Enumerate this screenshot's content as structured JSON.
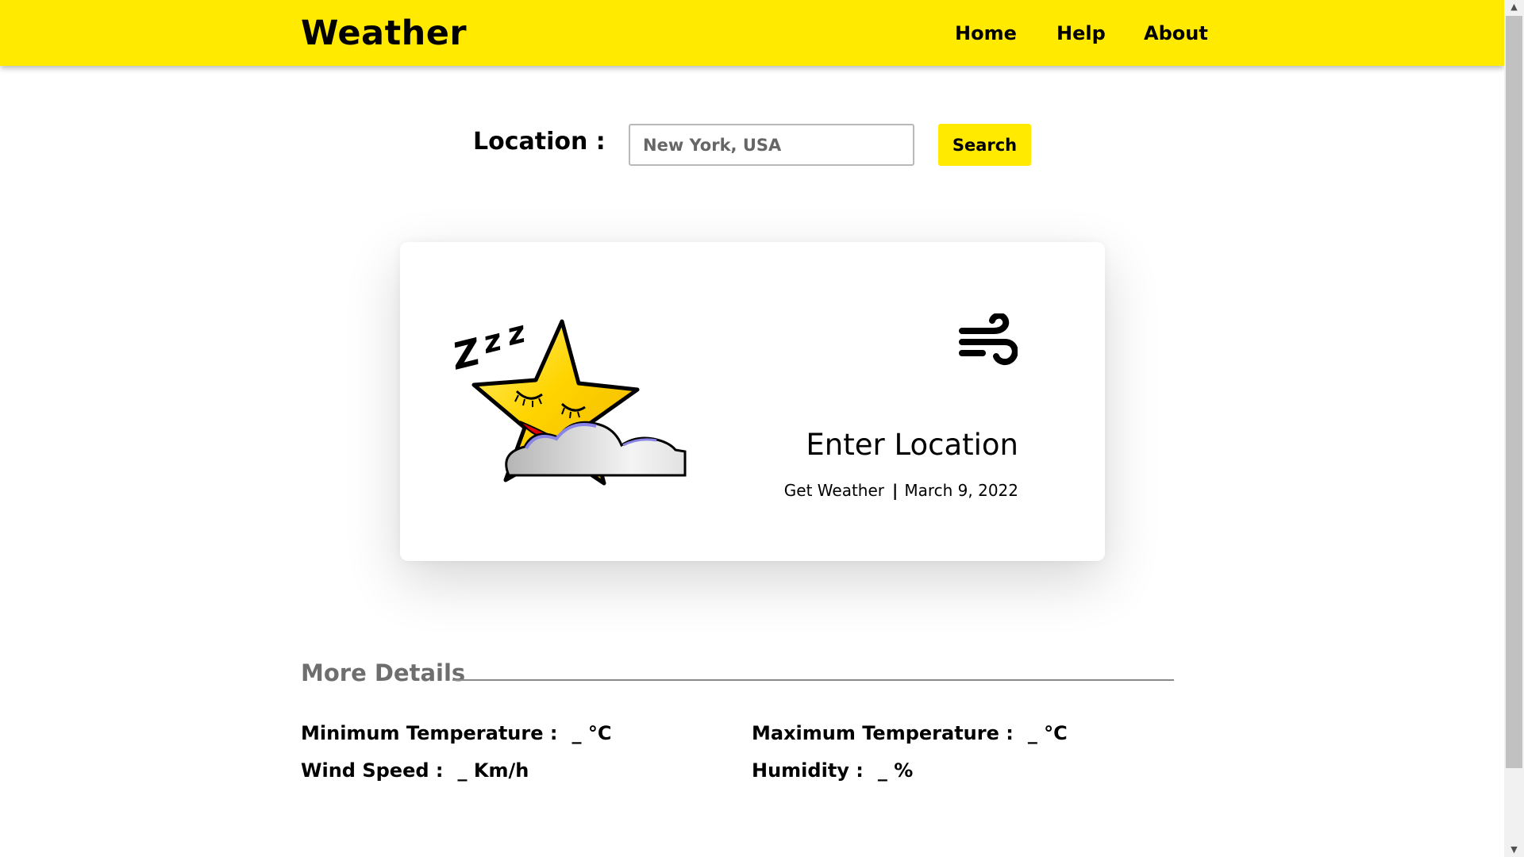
{
  "header": {
    "brand": "Weather",
    "nav": [
      "Home",
      "Help",
      "About"
    ],
    "color": "#ffea00"
  },
  "search": {
    "label": "Location :",
    "placeholder": "New York, USA",
    "value": "",
    "button_label": "Search"
  },
  "card": {
    "icon_left": "sleeping-star-cloud-illustration",
    "icon_right": "wind-icon",
    "title": "Enter Location",
    "subtitle": "Get Weather",
    "separator": "|",
    "date": "March 9, 2022"
  },
  "details": {
    "heading": "More Details",
    "items": [
      {
        "label": "Minimum Temperature :",
        "value": "_ °C"
      },
      {
        "label": "Maximum Temperature :",
        "value": "_ °C"
      },
      {
        "label": "Wind Speed :",
        "value": "_ Km/h"
      },
      {
        "label": "Humidity :",
        "value": "_ %"
      }
    ]
  }
}
